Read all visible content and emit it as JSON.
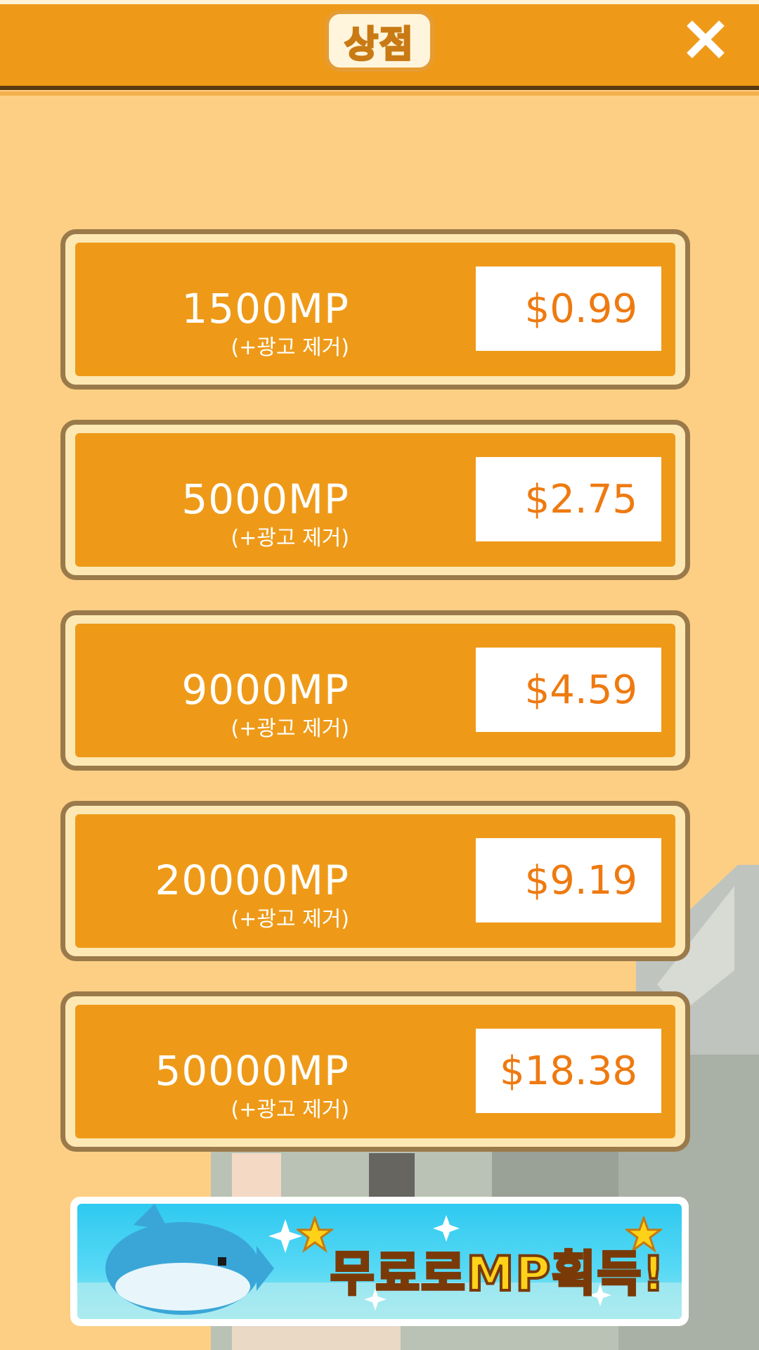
{
  "header": {
    "title": "상점",
    "close_icon": "close-icon"
  },
  "shop": {
    "items": [
      {
        "amount": "1500MP",
        "note": "(+광고 제거)",
        "price": "$0.99"
      },
      {
        "amount": "5000MP",
        "note": "(+광고 제거)",
        "price": "$2.75"
      },
      {
        "amount": "9000MP",
        "note": "(+광고 제거)",
        "price": "$4.59"
      },
      {
        "amount": "20000MP",
        "note": "(+광고 제거)",
        "price": "$9.19"
      },
      {
        "amount": "50000MP",
        "note": "(+광고 제거)",
        "price": "$18.38"
      }
    ]
  },
  "banner": {
    "label": "무료로MP획득!"
  },
  "colors": {
    "background": "#fdcf84",
    "header": "#ee9a18",
    "item": "#ee9a18",
    "price_text": "#ee7a10"
  }
}
